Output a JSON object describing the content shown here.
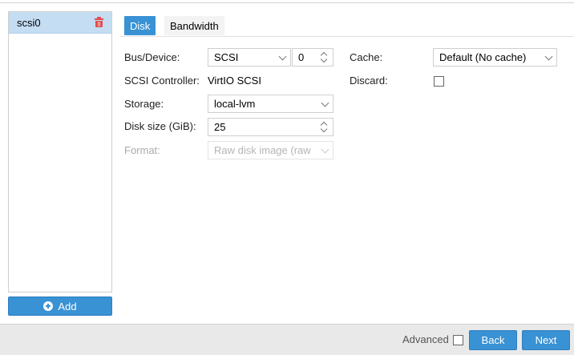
{
  "disk_list": {
    "items": [
      {
        "label": "scsi0",
        "selected": true
      }
    ],
    "add_label": "Add"
  },
  "tabs": [
    {
      "label": "Disk",
      "active": true
    },
    {
      "label": "Bandwidth",
      "active": false
    }
  ],
  "form": {
    "bus_device": {
      "label": "Bus/Device:",
      "bus_value": "SCSI",
      "device_value": "0"
    },
    "scsi_controller": {
      "label": "SCSI Controller:",
      "value": "VirtIO SCSI"
    },
    "storage": {
      "label": "Storage:",
      "value": "local-lvm"
    },
    "disk_size": {
      "label": "Disk size (GiB):",
      "value": "25"
    },
    "format": {
      "label": "Format:",
      "value": "Raw disk image (raw",
      "disabled": true
    },
    "cache": {
      "label": "Cache:",
      "value": "Default (No cache)"
    },
    "discard": {
      "label": "Discard:",
      "checked": false
    }
  },
  "footer": {
    "advanced_label": "Advanced",
    "advanced_checked": false,
    "back_label": "Back",
    "next_label": "Next"
  },
  "colors": {
    "accent": "#3892d4",
    "selected_row": "#c5ddf3",
    "delete_icon": "#e14c4c"
  }
}
